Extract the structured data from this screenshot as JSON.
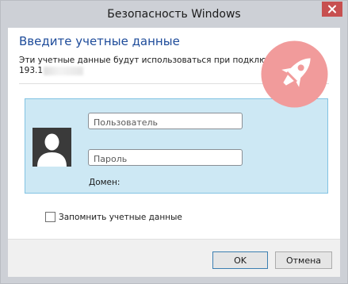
{
  "window": {
    "title": "Безопасность Windows"
  },
  "dialog": {
    "heading": "Введите учетные данные",
    "description_line1": "Эти учетные данные будут использоваться при подключении к",
    "description_ip": "193.1"
  },
  "credentials": {
    "username_placeholder": "Пользователь",
    "password_placeholder": "Пароль",
    "domain_label": "Домен:"
  },
  "remember": {
    "label": "Запомнить учетные данные",
    "checked": false
  },
  "buttons": {
    "ok": "OK",
    "cancel": "Отмена"
  },
  "icons": {
    "close": "close-icon",
    "avatar": "user-avatar-icon",
    "overlay": "rocket-icon"
  },
  "colors": {
    "heading": "#1d4b9a",
    "close_button": "#c75050",
    "panel_bg": "#cde8f4",
    "panel_border": "#82c3e3",
    "rocket_circle": "#f19b9b"
  }
}
